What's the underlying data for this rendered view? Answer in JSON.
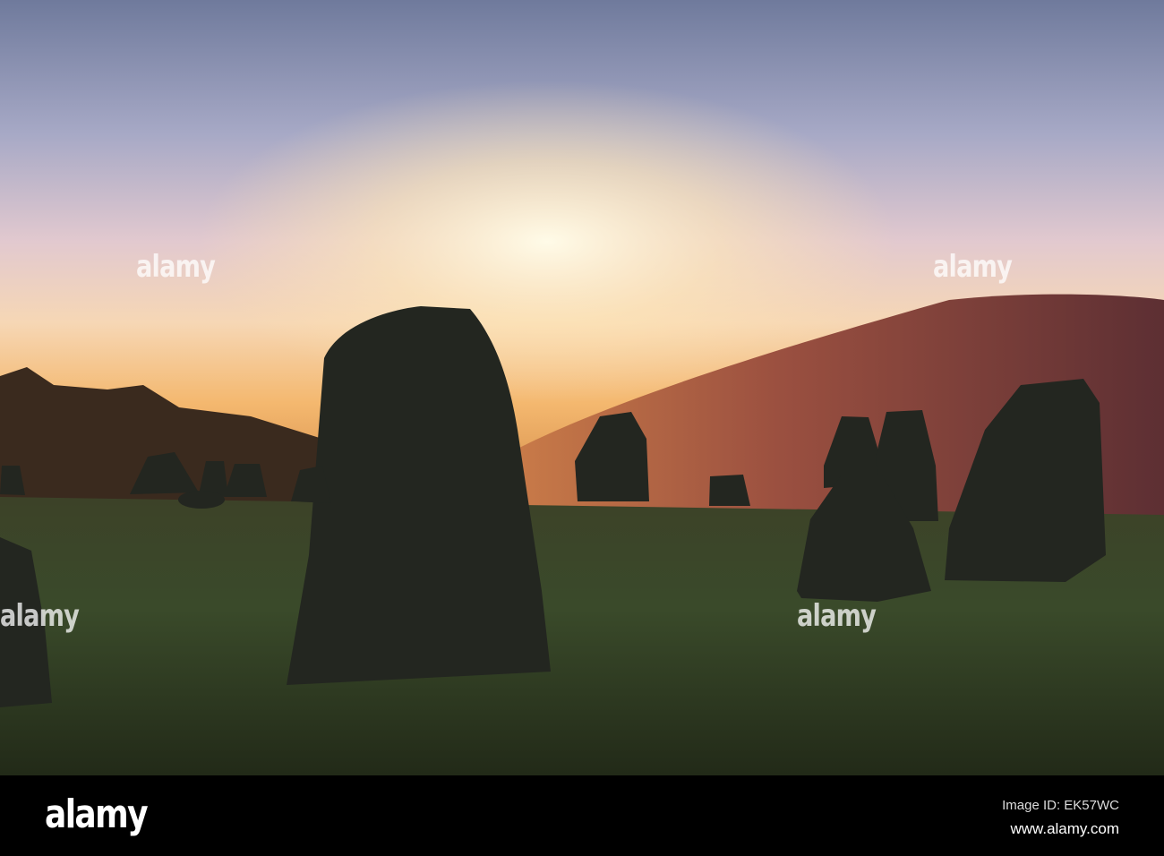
{
  "photo": {
    "subject": "Standing stones at sunrise",
    "watermark": "alamy"
  },
  "footer": {
    "logo": "alamy",
    "image_id": "Image ID: EK57WC",
    "website": "www.alamy.com"
  },
  "colors": {
    "sky_top": "#7c86a6",
    "sun_glow": "#fff3d0",
    "hill": "#7a3a30",
    "grass": "#2f3a22",
    "stone": "#1f2320"
  }
}
